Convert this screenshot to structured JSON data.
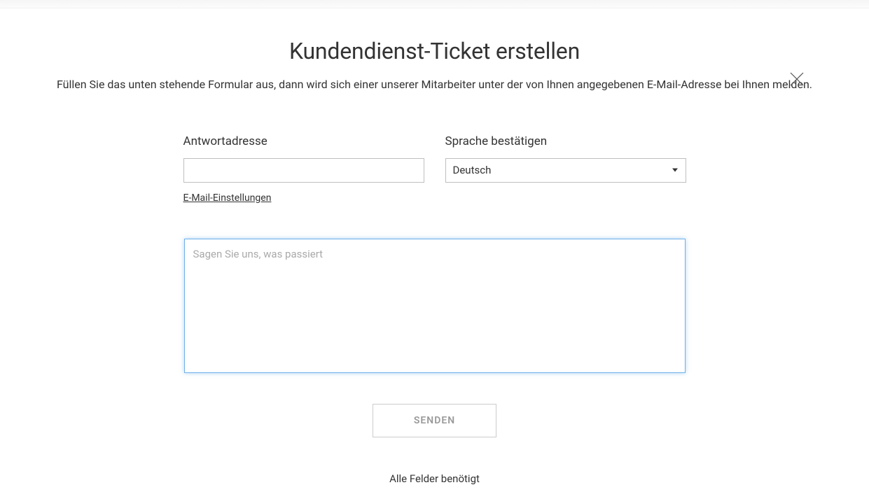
{
  "title": "Kundendienst-Ticket erstellen",
  "subtitle": "Füllen Sie das unten stehende Formular aus, dann wird sich einer unserer Mitarbeiter unter der von Ihnen angegebenen E-Mail-Adresse bei Ihnen melden.",
  "form": {
    "reply_address": {
      "label": "Antwortadresse",
      "value": "",
      "email_settings_link": "E-Mail-Einstellungen"
    },
    "language": {
      "label": "Sprache bestätigen",
      "selected": "Deutsch"
    },
    "message": {
      "placeholder": "Sagen Sie uns, was passiert",
      "value": ""
    },
    "submit_label": "SENDEN",
    "required_note": "Alle Felder benötigt"
  }
}
